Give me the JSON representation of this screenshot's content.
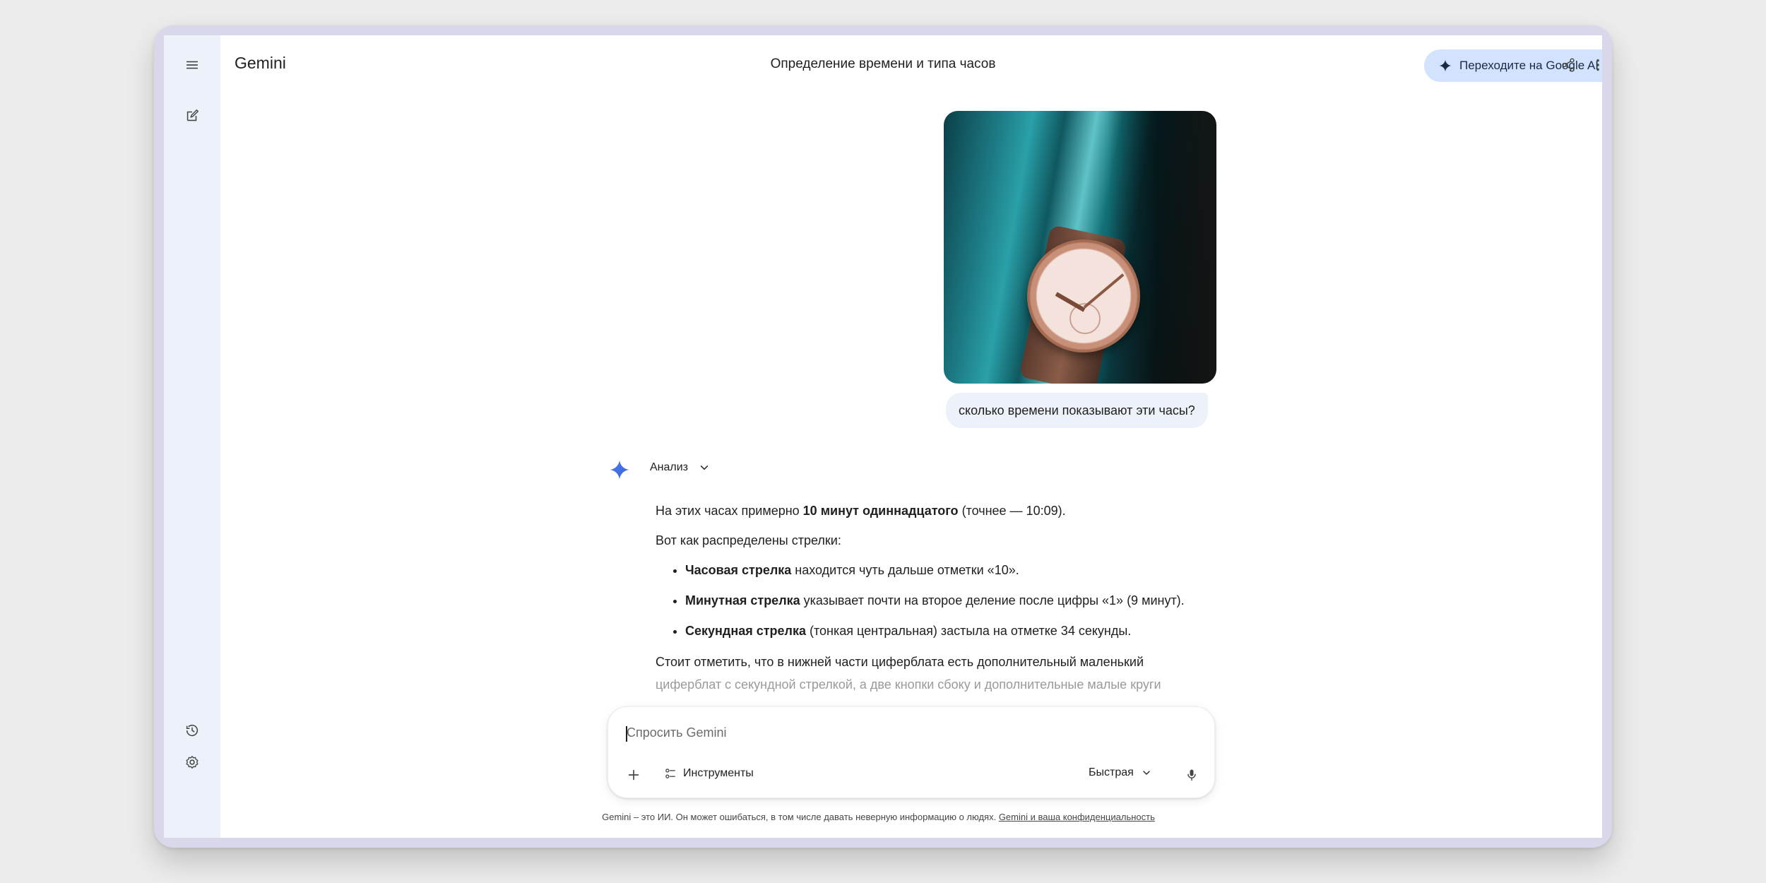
{
  "header": {
    "brand": "Gemini",
    "conversation_title": "Определение времени и типа часов",
    "upgrade_label": "Переходите на Google AI Plus"
  },
  "icons": {
    "menu": "menu-icon",
    "new_chat": "edit-icon",
    "history": "history-icon",
    "settings": "settings-icon",
    "share": "share-icon",
    "more": "more-vert-icon",
    "plus": "plus-icon",
    "tools": "tune-icon",
    "mic": "mic-icon",
    "chevron": "chevron-down-icon",
    "spark": "gemini-spark-icon"
  },
  "colors": {
    "sidebar_bg": "#edf1fa",
    "upgrade_bg": "#d3e3fd",
    "spark_accent": "#4a7cf0",
    "bubble_bg": "#edf1fa"
  },
  "conversation": {
    "user_prompt": "сколько времени показывают эти часы?",
    "analysis_label": "Анализ",
    "answer": {
      "p1_before": "На этих часах примерно ",
      "p1_bold": "10 минут одиннадцатого",
      "p1_after": " (точнее — 10:09).",
      "p2": "Вот как распределены стрелки:",
      "bullets": [
        {
          "bold": "Часовая стрелка",
          "text": " находится чуть дальше отметки «10»."
        },
        {
          "bold": "Минутная стрелка",
          "text": " указывает почти на второе деление после цифры «1» (9 минут)."
        },
        {
          "bold": "Секундная стрелка",
          "text": " (тонкая центральная) застыла на отметке 34 секунды."
        }
      ],
      "p3_line1": "Стоит отметить, что в нижней части циферблата есть дополнительный маленький",
      "p3_line2": "циферблат с секундной стрелкой, а две кнопки сбоку и дополнительные малые круги"
    }
  },
  "composer": {
    "placeholder": "Спросить Gemini",
    "tools_label": "Инструменты",
    "mode_label": "Быстрая"
  },
  "footer": {
    "disclaimer": "Gemini – это ИИ. Он может ошибаться, в том числе давать неверную информацию о людях. ",
    "privacy_link": "Gemini и ваша конфиденциальность"
  }
}
